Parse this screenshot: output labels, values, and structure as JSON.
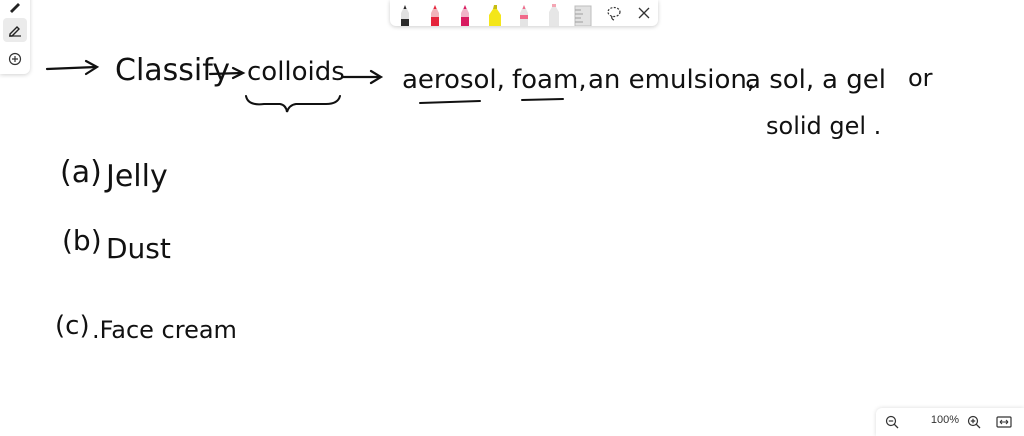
{
  "canvas": {
    "line1": {
      "arrow_text": "Classify",
      "target": "colloids",
      "items": [
        "aerosol,",
        "foam,",
        "an emulsion,",
        "a sol,",
        "a gel",
        "or"
      ],
      "continuation": "solid gel ."
    },
    "questions": [
      {
        "label": "(a)",
        "text": "Jelly"
      },
      {
        "label": "(b)",
        "text": "Dust"
      },
      {
        "label": "(c)",
        "text": ".Face cream"
      }
    ]
  },
  "pen_bar": {
    "pens": [
      {
        "name": "black-pen",
        "color": "#2b2b2b"
      },
      {
        "name": "red-pen",
        "color": "#e5243b"
      },
      {
        "name": "magenta-pen",
        "color": "#d81b60"
      },
      {
        "name": "yellow-highlighter",
        "color": "#f4e61a"
      },
      {
        "name": "pink-light-pen",
        "color": "#f06a8a"
      },
      {
        "name": "pink-highlighter",
        "color": "#f4a6b4"
      },
      {
        "name": "grey-ruler",
        "color": "#bdbdbd"
      }
    ]
  },
  "zoom": {
    "level": "100%"
  },
  "colors": {
    "ink": "#111111",
    "toolbar_bg": "#ffffff"
  }
}
